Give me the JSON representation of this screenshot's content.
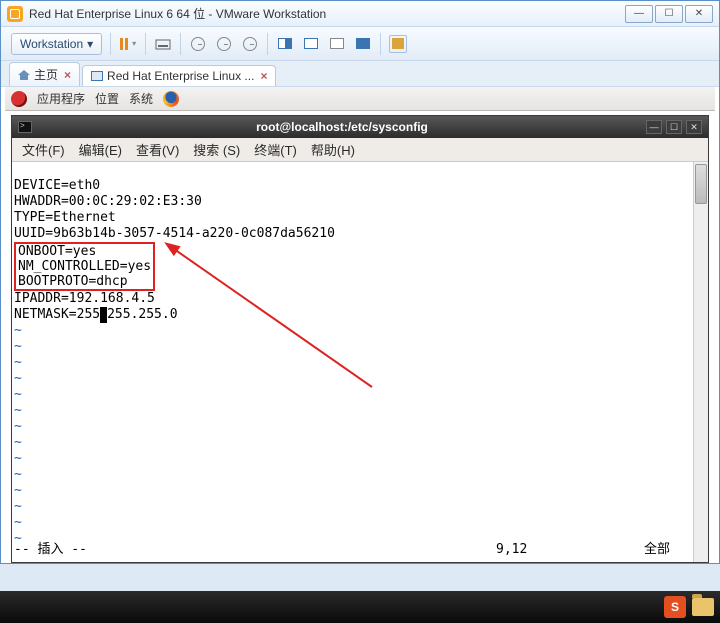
{
  "window": {
    "title": "Red Hat Enterprise Linux 6 64 位 - VMware Workstation"
  },
  "toolbar": {
    "workstation_label": "Workstation",
    "dropdown_glyph": "▾"
  },
  "tabs": {
    "home": "主页",
    "vm": "Red Hat Enterprise Linux ..."
  },
  "gnome": {
    "apps": "应用程序",
    "places": "位置",
    "system": "系统"
  },
  "terminal": {
    "title": "root@localhost:/etc/sysconfig",
    "menu": {
      "file": "文件(F)",
      "edit": "编辑(E)",
      "view": "查看(V)",
      "search": "搜索 (S)",
      "terminal": "终端(T)",
      "help": "帮助(H)"
    },
    "lines": {
      "l1": "DEVICE=eth0",
      "l2": "HWADDR=00:0C:29:02:E3:30",
      "l3": "TYPE=Ethernet",
      "l4": "UUID=9b63b14b-3057-4514-a220-0c087da56210",
      "box1": "ONBOOT=yes",
      "box2": "NM_CONTROLLED=yes",
      "box3": "BOOTPROTO=dhcp",
      "l8": "IPADDR=192.168.4.5",
      "l9a": "NETMASK=255",
      "l9b": "255.255.0"
    },
    "status": {
      "mode": "-- 插入 --",
      "pos": "9,12",
      "scroll": "全部"
    }
  }
}
